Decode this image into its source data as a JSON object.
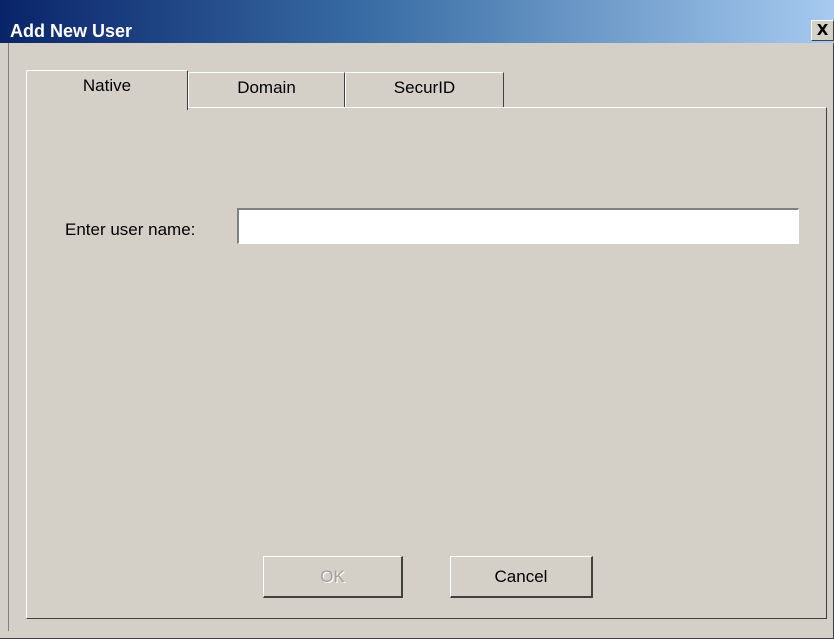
{
  "window": {
    "title": "Add New User",
    "close_glyph": "X",
    "close_icon": "close-icon"
  },
  "tabs": [
    {
      "label": "Native",
      "active": true
    },
    {
      "label": "Domain",
      "active": false
    },
    {
      "label": "SecurID",
      "active": false
    }
  ],
  "form": {
    "username_label": "Enter user name:",
    "username_value": "",
    "username_placeholder": ""
  },
  "buttons": {
    "ok_label": "OK",
    "ok_enabled": false,
    "cancel_label": "Cancel"
  },
  "colors": {
    "title_bar_start": "#0a246a",
    "title_bar_end": "#a6caf0",
    "dialog_face": "#d4d0c8",
    "disabled_text": "#a0a0a0"
  }
}
